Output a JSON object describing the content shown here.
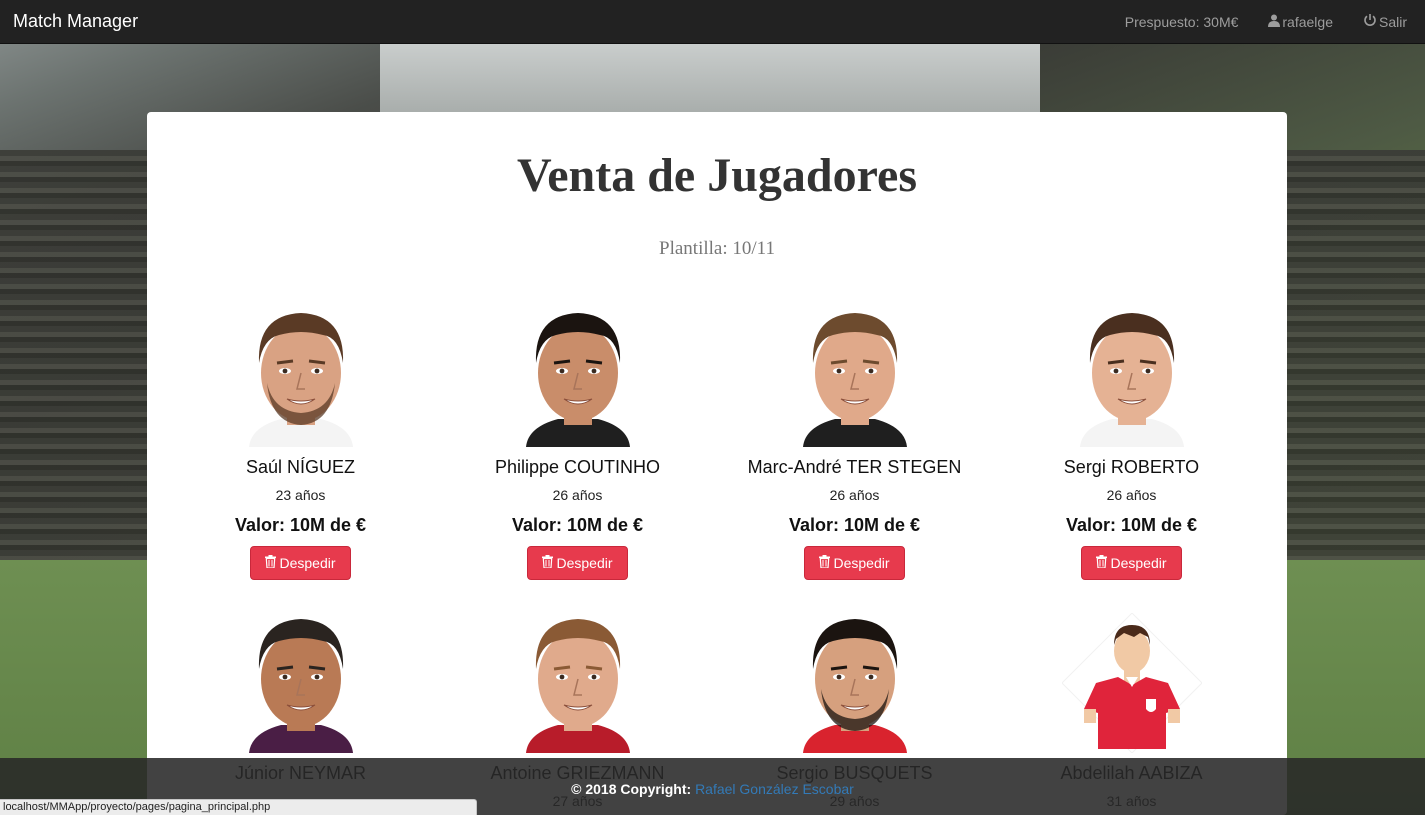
{
  "navbar": {
    "brand": "Match Manager",
    "budget": "Prespuesto: 30M€",
    "user": "rafaelge",
    "logout": "Salir"
  },
  "page": {
    "title": "Venta de Jugadores",
    "squad": "Plantilla: 10/11"
  },
  "players": [
    {
      "name": "Saúl NÍGUEZ",
      "age": "23 años",
      "value": "Valor: 10M de €",
      "button": "Despedir",
      "skin": "#d9a283",
      "hair": "#5a3a25",
      "shirt": "#f4f4f4",
      "beard": true
    },
    {
      "name": "Philippe COUTINHO",
      "age": "26 años",
      "value": "Valor: 10M de €",
      "button": "Despedir",
      "skin": "#c98d6a",
      "hair": "#1b1410",
      "shirt": "#1f1f1f",
      "beard": false
    },
    {
      "name": "Marc-André TER STEGEN",
      "age": "26 años",
      "value": "Valor: 10M de €",
      "button": "Despedir",
      "skin": "#e0a98a",
      "hair": "#6d4b2e",
      "shirt": "#1f1f1f",
      "beard": false
    },
    {
      "name": "Sergi ROBERTO",
      "age": "26 años",
      "value": "Valor: 10M de €",
      "button": "Despedir",
      "skin": "#e5b294",
      "hair": "#4a2f1f",
      "shirt": "#f4f4f4",
      "beard": false
    },
    {
      "name": "Júnior NEYMAR",
      "age": "",
      "value": "",
      "button": "",
      "skin": "#b97a55",
      "hair": "#2a2420",
      "shirt": "#4a1e45",
      "beard": false
    },
    {
      "name": "Antoine GRIEZMANN",
      "age": "27 años",
      "value": "",
      "button": "",
      "skin": "#e0aa8c",
      "hair": "#8a5a35",
      "shirt": "#b81c2a",
      "beard": false
    },
    {
      "name": "Sergio BUSQUETS",
      "age": "29 años",
      "value": "",
      "button": "",
      "skin": "#d6a07e",
      "hair": "#1b1410",
      "shirt": "#d9232e",
      "beard": true
    },
    {
      "name": "Abdelilah AABIZA",
      "age": "31 años",
      "value": "",
      "button": "",
      "skin": "#f1c9a5",
      "hair": "#4a2a1a",
      "shirt": "#e0243b",
      "beard": false,
      "avatar": true
    }
  ],
  "footer": {
    "copyright": "© 2018 Copyright:",
    "author": "Rafael González Escobar"
  },
  "statusbar": "localhost/MMApp/proyecto/pages/pagina_principal.php",
  "colors": {
    "navbar": "#222222",
    "danger": "#e73a4d",
    "link": "#337ab7"
  }
}
